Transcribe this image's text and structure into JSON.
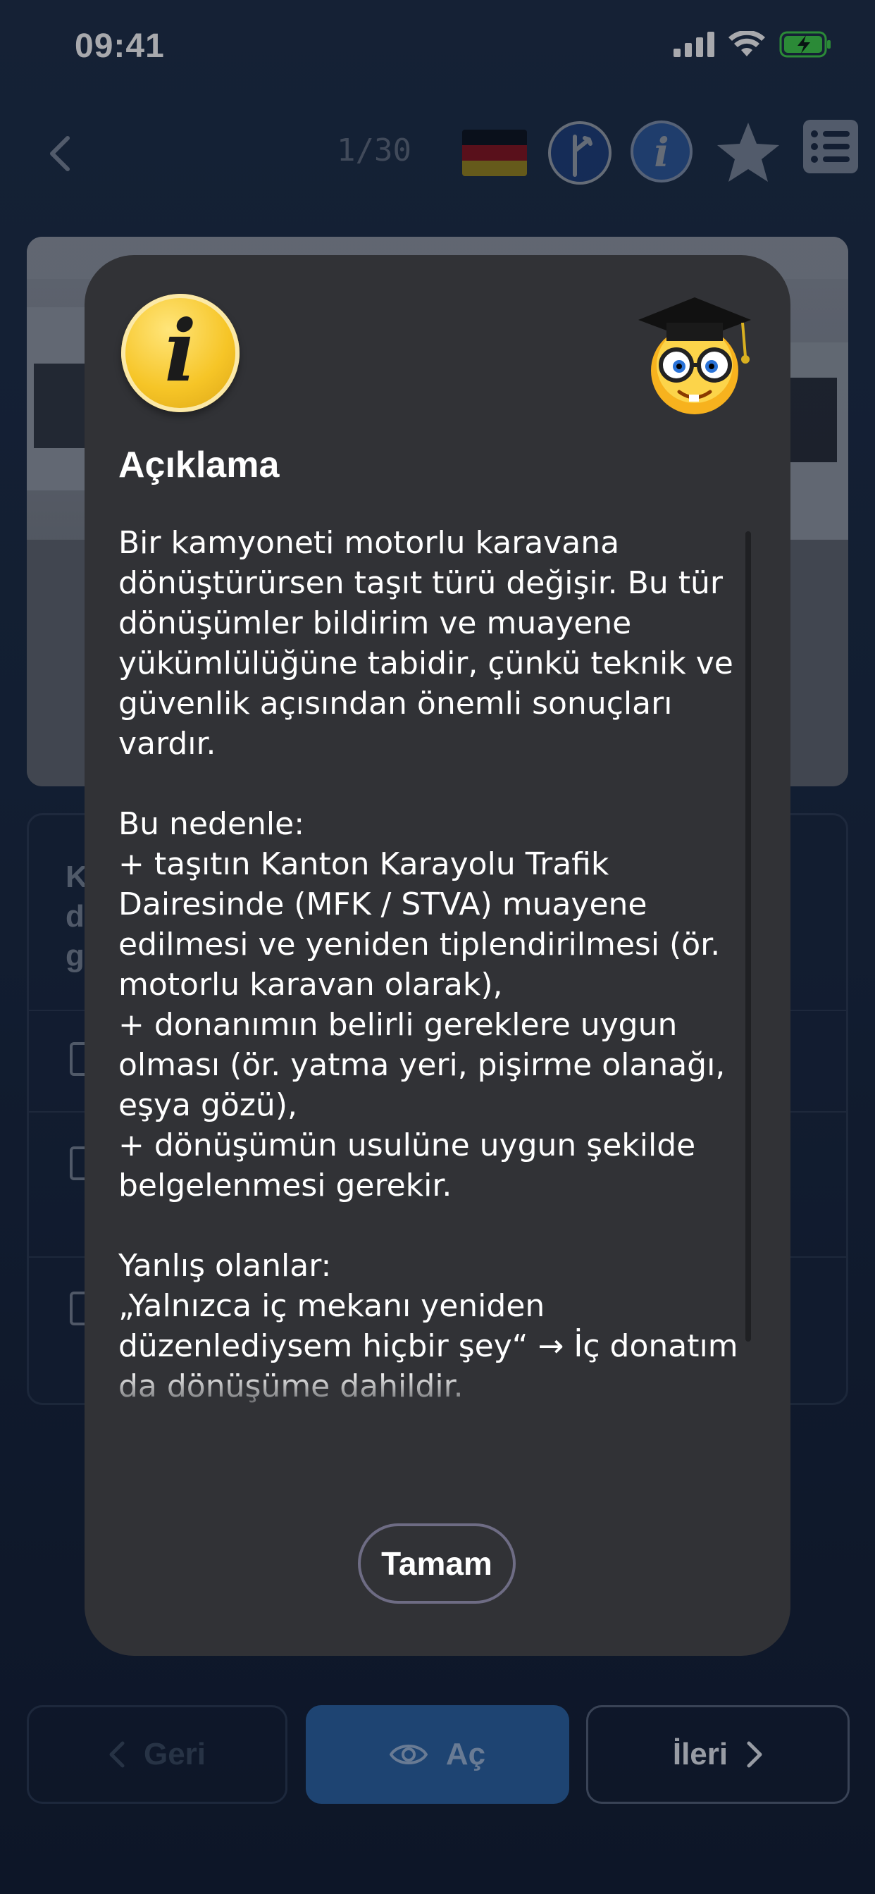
{
  "status_bar": {
    "time": "09:41"
  },
  "nav": {
    "counter": "1/30",
    "flag_colors": [
      "#000000",
      "#dd0000",
      "#ffce00"
    ],
    "icons": [
      "back-icon",
      "flag-germany-icon",
      "route-icon",
      "info-icon",
      "star-icon",
      "list-icon"
    ]
  },
  "background_question": {
    "partial_text_lines": [
      "K",
      "d",
      "g"
    ]
  },
  "modal": {
    "title": "Açıklama",
    "body": "Bir kamyoneti motorlu karavana dönüştürürsen taşıt türü değişir. Bu tür dönüşümler bildirim ve muayene yükümlülüğüne tabidir, çünkü teknik ve güvenlik açısından önemli sonuçları vardır.\n\nBu nedenle:\n+ taşıtın Kanton Karayolu Trafik Dairesinde (MFK / STVA) muayene edilmesi ve yeniden tiplendirilmesi (ör. motorlu karavan olarak),\n+ donanımın belirli gereklere uygun olması (ör. yatma yeri, pişirme olanağı, eşya gözü),\n+ dönüşümün usulüne uygun şekilde belgelenmesi gerekir.\n\nYanlış olanlar:\n„Yalnızca iç mekanı yeniden düzenlediysem hiçbir şey“ → İç donatım da dönüşüme dahildir.\n\n„Taşıtı bir uzman servise kontrol",
    "ok_label": "Tamam"
  },
  "bottom": {
    "prev_label": "Geri",
    "show_label": "Aç",
    "next_label": "İleri"
  },
  "colors": {
    "modal_bg": "#313236",
    "accent_blue": "#2b64a5",
    "info_yellow": "#f6c527"
  }
}
